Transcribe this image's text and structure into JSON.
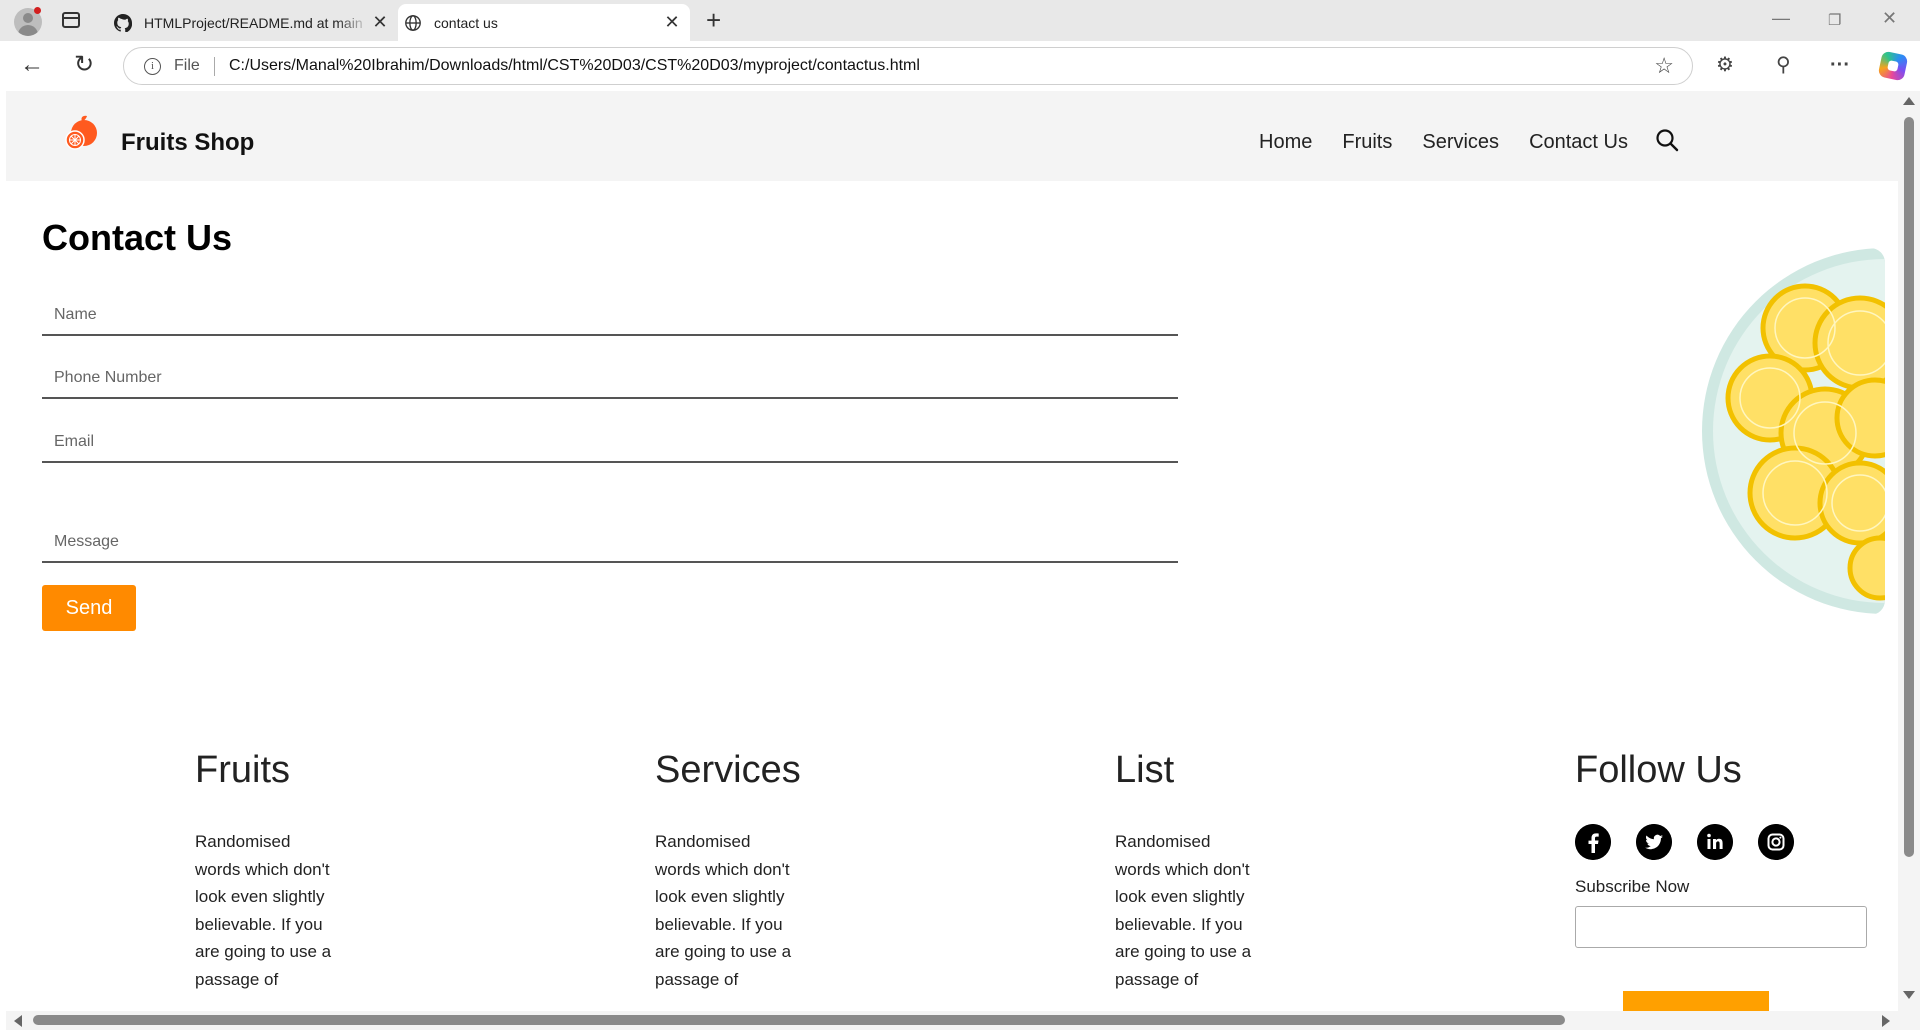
{
  "browser": {
    "tabs": [
      {
        "title": "HTMLProject/README.md at main",
        "icon": "github-icon"
      },
      {
        "title": "contact us",
        "icon": "globe-icon"
      }
    ],
    "address": {
      "scheme_label": "File",
      "url": "C:/Users/Manal%20Ibrahim/Downloads/html/CST%20D03/CST%20D03/myproject/contactus.html"
    }
  },
  "site": {
    "brand": "Fruits Shop",
    "nav": [
      "Home",
      "Fruits",
      "Services",
      "Contact Us"
    ]
  },
  "contact": {
    "title": "Contact Us",
    "name_placeholder": "Name",
    "phone_placeholder": "Phone Number",
    "email_placeholder": "Email",
    "message_placeholder": "Message",
    "send_label": "Send"
  },
  "footer": {
    "columns": [
      {
        "title": "Fruits",
        "text": "Randomised words which don't look even slightly believable. If you are going to use a passage of"
      },
      {
        "title": "Services",
        "text": "Randomised words which don't look even slightly believable. If you are going to use a passage of"
      },
      {
        "title": "List",
        "text": "Randomised words which don't look even slightly believable. If you are going to use a passage of"
      }
    ],
    "follow": {
      "title": "Follow Us",
      "social_icons": [
        "facebook-icon",
        "twitter-icon",
        "linkedin-icon",
        "instagram-icon"
      ],
      "subscribe_label": "Subscribe Now"
    }
  },
  "colors": {
    "accent": "#ff8a00",
    "header_bg": "#f4f4f4"
  }
}
